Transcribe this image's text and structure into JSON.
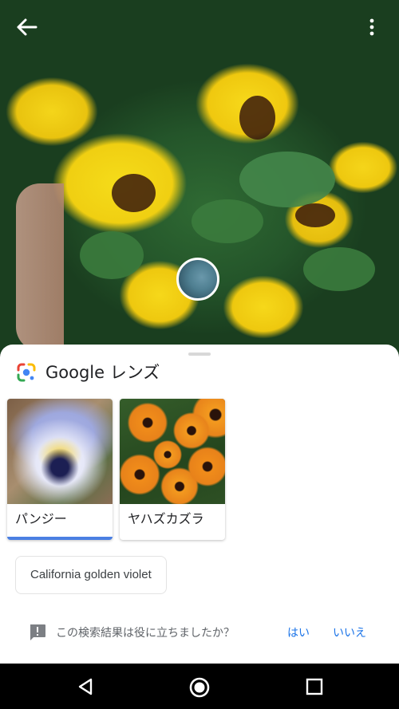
{
  "app": {
    "title": "Google レンズ"
  },
  "results": [
    {
      "label": "パンジー",
      "selected": true
    },
    {
      "label": "ヤハズカズラ",
      "selected": false
    }
  ],
  "suggestion_chip": "California golden violet",
  "feedback": {
    "question": "この検索結果は役に立ちましたか？",
    "yes": "はい",
    "no": "いいえ"
  },
  "icons": {
    "back": "arrow-back-icon",
    "more": "more-vert-icon",
    "lens": "google-lens-logo",
    "feedback": "feedback-icon",
    "nav_back": "triangle-back-icon",
    "nav_home": "circle-home-icon",
    "nav_recent": "square-recent-icon"
  },
  "colors": {
    "accent": "#1a73e8",
    "selection_underline": "#4a7fe2"
  }
}
